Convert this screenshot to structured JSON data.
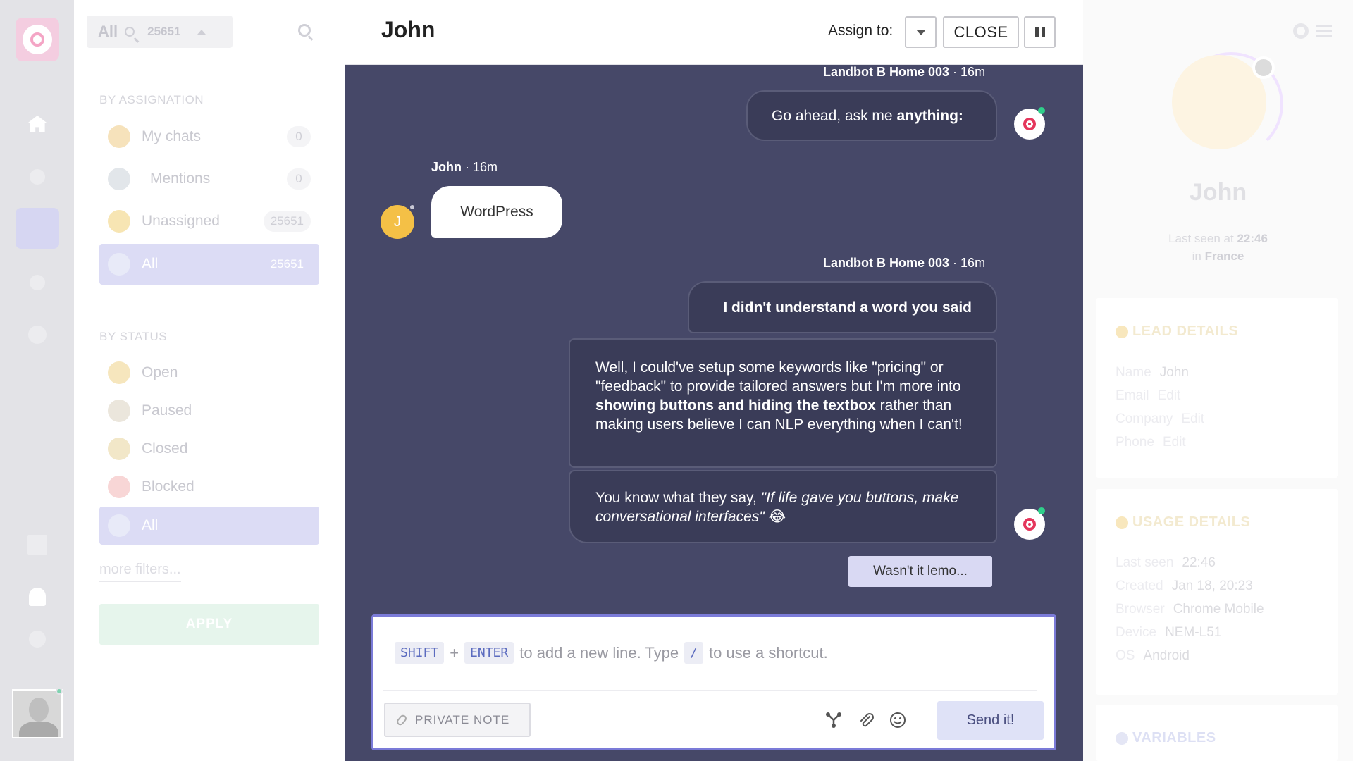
{
  "sidebar_filters": {
    "search": {
      "scope": "All",
      "count": "25651"
    },
    "by_assignation_title": "BY ASSIGNATION",
    "assignation_items": [
      {
        "label": "My chats",
        "count": "0"
      },
      {
        "label": "Mentions",
        "count": "0"
      },
      {
        "label": "Unassigned",
        "count": "25651"
      },
      {
        "label": "All",
        "count": "25651"
      }
    ],
    "by_status_title": "BY STATUS",
    "status_items": [
      {
        "label": "Open"
      },
      {
        "label": "Paused"
      },
      {
        "label": "Closed"
      },
      {
        "label": "Blocked"
      },
      {
        "label": "All"
      }
    ],
    "more_filters": "more filters...",
    "apply": "APPLY"
  },
  "header": {
    "title": "John",
    "assign_label": "Assign to:",
    "close_label": "CLOSE"
  },
  "messages": [
    {
      "sender": "Landbot B Home 003",
      "time": "· 16m",
      "text_before": "Go ahead, ask me ",
      "text_bold": "anything:"
    },
    {
      "sender": "John",
      "time": "· 16m",
      "text": "WordPress",
      "avatar_initial": "J"
    },
    {
      "sender": "Landbot B Home 003",
      "time": "· 16m",
      "bubble1": "I didn't understand a word you said",
      "bubble2_a": "Well, I could've setup some keywords like \"pricing\" or \"feedback\" to provide tailored answers but I'm more into ",
      "bubble2_bold": "showing buttons and hiding the textbox",
      "bubble2_b": " rather than making users believe I can NLP everything when I can't!",
      "bubble3_a": "You know what they say, ",
      "bubble3_italic": "\"If life gave you buttons, make conversational interfaces\"",
      "bubble3_emoji": "😂"
    }
  ],
  "quick_reply": "Wasn't it lemo...",
  "composer": {
    "key1": "SHIFT",
    "plus": "+",
    "key2": "ENTER",
    "hint_a": "to add a new line. Type",
    "key3": "/",
    "hint_b": "to use a shortcut.",
    "private_note": "PRIVATE NOTE",
    "send": "Send it!"
  },
  "profile": {
    "name": "John",
    "last_seen_prefix": "Last seen at",
    "last_seen_time": "22:46",
    "location_prefix": "in",
    "location": "France",
    "lead_title": "LEAD DETAILS",
    "lead": [
      {
        "key": "Name",
        "value": "John",
        "edit": ""
      },
      {
        "key": "Email",
        "value": "",
        "edit": "Edit"
      },
      {
        "key": "Company",
        "value": "",
        "edit": "Edit"
      },
      {
        "key": "Phone",
        "value": "",
        "edit": "Edit"
      }
    ],
    "usage_title": "USAGE DETAILS",
    "usage": [
      {
        "key": "Last seen",
        "value": "22:46"
      },
      {
        "key": "Created",
        "value": "Jan 18, 20:23"
      },
      {
        "key": "Browser",
        "value": "Chrome Mobile"
      },
      {
        "key": "Device",
        "value": "NEM-L51"
      },
      {
        "key": "OS",
        "value": "Android"
      }
    ],
    "variables_title": "VARIABLES"
  },
  "colors": {
    "chat_bg": "#464868",
    "bot_bubble": "#3a3c58",
    "accent": "#7b7bd8",
    "user_avatar": "#f4c046"
  }
}
